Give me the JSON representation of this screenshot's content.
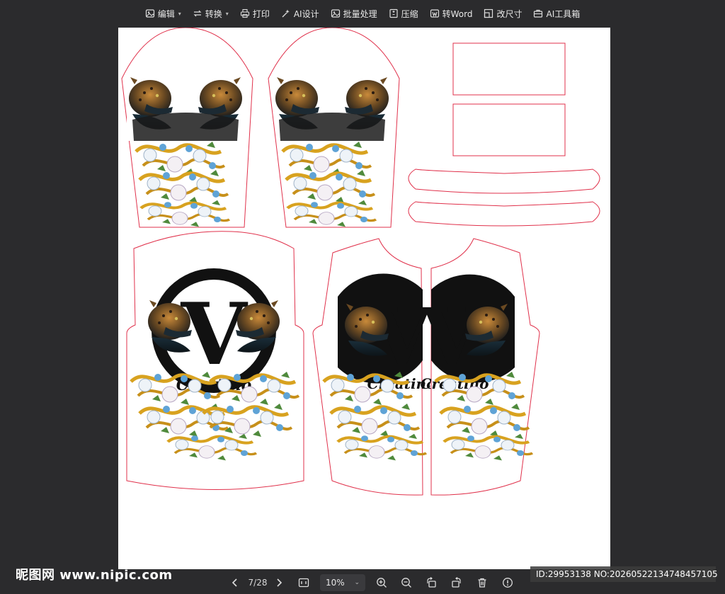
{
  "toolbar": {
    "items": [
      {
        "label": "编辑",
        "icon": "edit-icon",
        "caret": true
      },
      {
        "label": "转换",
        "icon": "convert-icon",
        "caret": true
      },
      {
        "label": "打印",
        "icon": "print-icon",
        "caret": false
      },
      {
        "label": "AI设计",
        "icon": "ai-design-icon",
        "caret": false
      },
      {
        "label": "批量处理",
        "icon": "batch-icon",
        "caret": false
      },
      {
        "label": "压缩",
        "icon": "compress-icon",
        "caret": false
      },
      {
        "label": "转Word",
        "icon": "word-icon",
        "caret": false
      },
      {
        "label": "改尺寸",
        "icon": "resize-icon",
        "caret": false
      },
      {
        "label": "AI工具箱",
        "icon": "ai-toolbox-icon",
        "caret": false
      }
    ]
  },
  "document": {
    "brand_letter": "V",
    "brand_script": "Creatino",
    "outline_color": "#e0314b",
    "background": "#ffffff"
  },
  "bottombar": {
    "page_indicator": "7/28",
    "zoom": "10%"
  },
  "watermark": {
    "site": "昵图网 www.nipic.com",
    "id_text": "ID:29953138 NO:20260522134748457105"
  },
  "colors": {
    "app_bg": "#2b2b2d",
    "toolbar_text": "#e8e8e8",
    "pattern_line": "#e0314b"
  }
}
